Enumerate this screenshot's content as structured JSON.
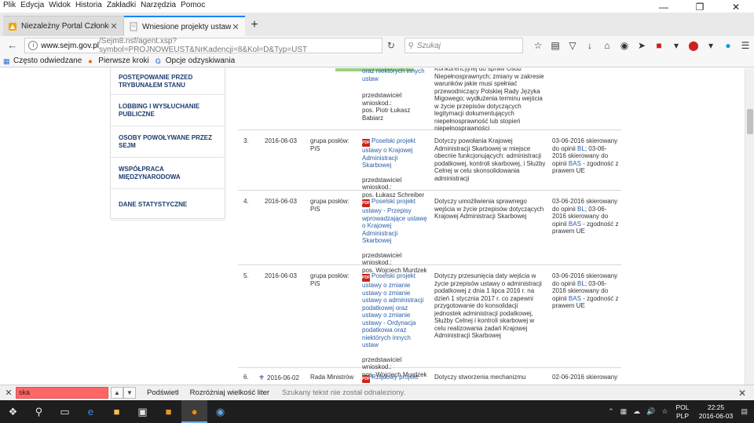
{
  "menu": [
    "Plik",
    "Edycja",
    "Widok",
    "Historia",
    "Zakładki",
    "Narzędzia",
    "Pomoc"
  ],
  "menu_underline": [
    "P",
    "E",
    "W",
    "H",
    "Z",
    "N",
    "c"
  ],
  "tabs": [
    {
      "label": "Niezależny Portal Członkó..."
    },
    {
      "label": "Wniesione projekty ustaw"
    }
  ],
  "url": {
    "host": "www.sejm.gov.pl",
    "path": "/Sejm8.nsf/agent.xsp?symbol=PROJNOWEUST&NrKadencji=8&Kol=D&Typ=UST"
  },
  "search": {
    "placeholder": "Szukaj"
  },
  "bookmarks": [
    "Często odwiedzane",
    "Pierwsze kroki",
    "Opcje odzyskiwania"
  ],
  "sidebar": [
    "Postępowanie przed Trybunałem Stanu",
    "Lobbing i wysłuchanie publiczne",
    "Osoby powoływane przez Sejm",
    "Współpraca międzynarodowa",
    "Dane statystyczne"
  ],
  "rows": [
    {
      "no": "",
      "date": "",
      "by": "",
      "project_link": "oraz niektórych innych ustaw",
      "rep_label": "przedstawiciel wnioskod.:",
      "rep": "pos. Piotr Łukasz Babiarz",
      "desc": "Konkurencyjnej do spraw Osób Niepełnosprawnych; zmiany w zakresie warunków jakie musi spełniać przewodniczący Polskiej Rady Języka Migowego; wydłużenia terminu wejścia w życie przepisów dotyczących legitymacji dokumentujących niepełnosprawność lub stopień niepełnosprawności",
      "opinion": ""
    },
    {
      "no": "3.",
      "date": "2016-06-03",
      "by": "grupa posłów: PiS",
      "project_link": "Poselski projekt ustawy o Krajowej Administracji Skarbowej",
      "rep_label": "przedstawiciel wnioskod.:",
      "rep": "pos. Łukasz Schreiber",
      "desc": "Dotyczy powołania Krajowej Administracji Skarbowej w miejsce obecnie funkcjonujących: administracji podatkowej, kontroli skarbowej, i Służby Celnej w celu skonsolidowania administracji",
      "opinion_pre": "03-06-2016 skierowany do opinii ",
      "opinion_a": "BL",
      "opinion_mid": "; 03-06-2016 skierowany do opinii ",
      "opinion_b": "BAS",
      "opinion_post": " - zgodność z prawem UE"
    },
    {
      "no": "4.",
      "date": "2016-06-03",
      "by": "grupa posłów: PiS",
      "project_link": "Poselski projekt ustawy - Przepisy wprowadzające ustawę o Krajowej Administracji Skarbowej",
      "rep_label": "przedstawiciel wnioskod.:",
      "rep": "pos. Wojciech Murdzek",
      "desc": "Dotyczy umożliwienia sprawnego wejścia w życie przepisów dotyczących Krajowej Administracji Skarbowej",
      "opinion_pre": "03-06-2016 skierowany do opinii ",
      "opinion_a": "BL",
      "opinion_mid": "; 03-06-2016 skierowany do opinii ",
      "opinion_b": "BAS",
      "opinion_post": " - zgodność z prawem UE"
    },
    {
      "no": "5.",
      "date": "2016-06-03",
      "by": "grupa posłów: PiS",
      "project_link": "Poselski projekt ustawy o zmianie ustawy o zmianie ustawy o administracji podatkowej oraz ustawy o zmianie ustawy - Ordynacja podatkowa oraz niektórych innych ustaw",
      "rep_label": "przedstawiciel wnioskod.:",
      "rep": "pos. Wojciech Murdzek",
      "desc": "Dotyczy przesunięcia daty wejścia w życie przepisów ustawy o administracji podatkowej z dnia 1 lipca 2016 r. na dzień 1 stycznia 2017 r. co zapewni przygotowanie do konsolidacji jednostek administracji podatkowej, Służby Celnej i kontroli skarbowej w celu realizowania zadań Krajowej Administracji Skarbowej",
      "opinion_pre": "03-06-2016 skierowany do opinii ",
      "opinion_a": "BL",
      "opinion_mid": "; 03-06-2016 skierowany do opinii ",
      "opinion_b": "BAS",
      "opinion_post": " - zgodność z prawem UE"
    },
    {
      "no": "6.",
      "date": "2016-06-02",
      "by": "Rada Ministrów",
      "project_link": "Rządowy projekt",
      "desc": "Dotyczy stworzenia mechanizmu",
      "opinion_pre": "02-06-2016 skierowany"
    }
  ],
  "findbar": {
    "value": "ska",
    "highlight_all": "Podświetl",
    "match_case": "Rozróżniaj wielkość liter",
    "status": "Szukany tekst nie został odnaleziony."
  },
  "taskbar": {
    "lang_top": "POL",
    "lang_bottom": "PLP",
    "time": "22:25",
    "date": "2016-06-03"
  },
  "colors": {
    "accent": "#0a84ff",
    "link": "#2a5ea8",
    "sidebar_text": "#1c3c6f",
    "find_error": "#ff6666",
    "taskbar": "#1e1e1e"
  }
}
